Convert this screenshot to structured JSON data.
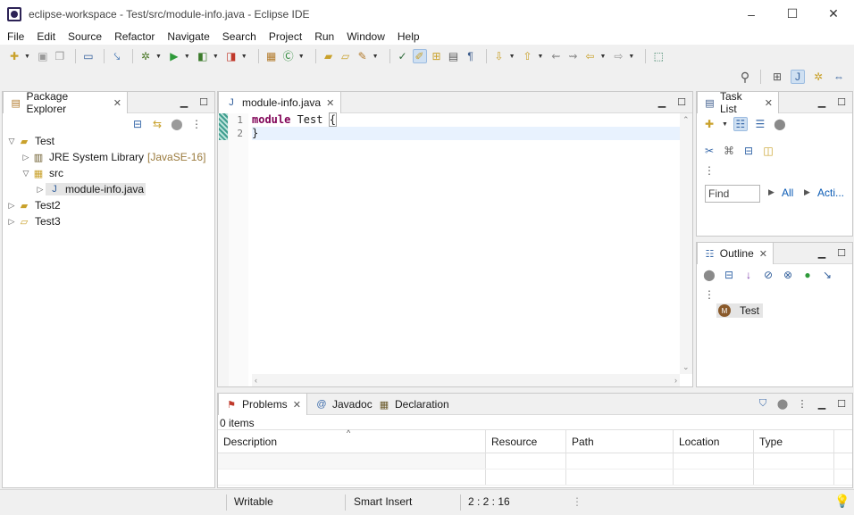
{
  "window": {
    "title": "eclipse-workspace - Test/src/module-info.java - Eclipse IDE",
    "minimize": "–",
    "maximize": "☐",
    "close": "✕"
  },
  "menu": [
    "File",
    "Edit",
    "Source",
    "Refactor",
    "Navigate",
    "Search",
    "Project",
    "Run",
    "Window",
    "Help"
  ],
  "package_explorer": {
    "tab_label": "Package Explorer",
    "tree": {
      "project": "Test",
      "jre": "JRE System Library",
      "jre_decoration": "[JavaSE-16]",
      "src": "src",
      "file": "module-info.java",
      "project2": "Test2",
      "project3": "Test3"
    }
  },
  "editor": {
    "tab_label": "module-info.java",
    "lines": [
      {
        "number": "1",
        "keyword": "module",
        "text": " Test ",
        "bracket": "{"
      },
      {
        "number": "2",
        "keyword": "",
        "text": "}",
        "bracket": ""
      }
    ]
  },
  "task_list": {
    "tab_label": "Task List",
    "find_placeholder": "Find",
    "all_link": "All",
    "activate_link": "Acti..."
  },
  "outline": {
    "tab_label": "Outline",
    "node": "Test",
    "node_icon": "M"
  },
  "problems": {
    "tabs": [
      "Problems",
      "Javadoc",
      "Declaration"
    ],
    "count": "0 items",
    "columns": [
      "Description",
      "Resource",
      "Path",
      "Location",
      "Type"
    ]
  },
  "status": {
    "writable": "Writable",
    "insert_mode": "Smart Insert",
    "position": "2 : 2 : 16"
  },
  "colors": {
    "keyword": "#7f0055",
    "current_line": "#e8f2fe",
    "link": "#0a5bb5",
    "decoration": "#9a7a3c"
  }
}
